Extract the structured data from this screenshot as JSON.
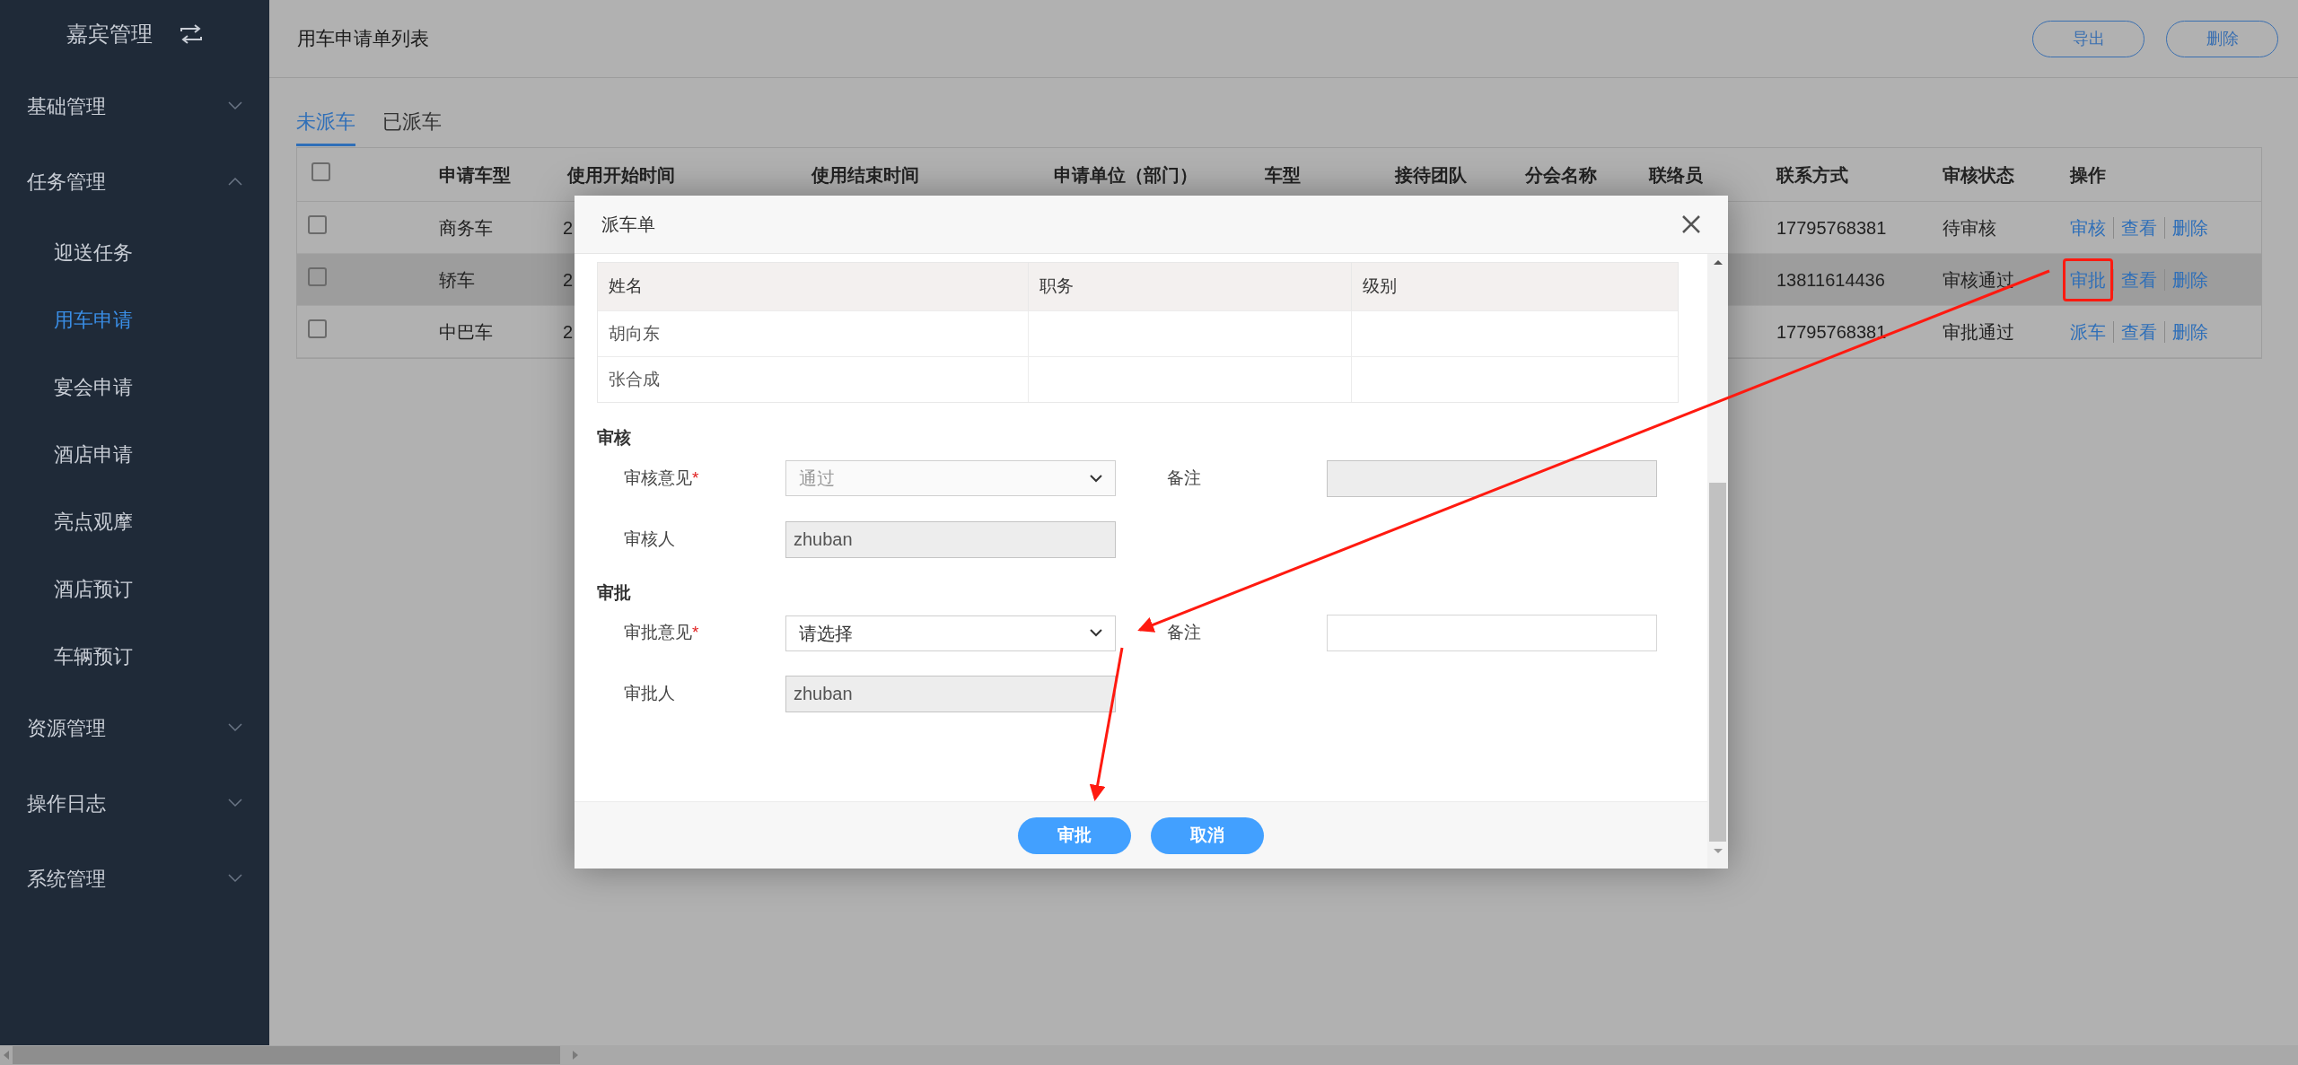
{
  "sidebar": {
    "title": "嘉宾管理",
    "groups": [
      {
        "label": "基础管理",
        "expanded": false
      },
      {
        "label": "任务管理",
        "expanded": true,
        "children": [
          {
            "label": "迎送任务",
            "selected": false
          },
          {
            "label": "用车申请",
            "selected": true
          },
          {
            "label": "宴会申请",
            "selected": false
          },
          {
            "label": "酒店申请",
            "selected": false
          },
          {
            "label": "亮点观摩",
            "selected": false
          },
          {
            "label": "酒店预订",
            "selected": false
          },
          {
            "label": "车辆预订",
            "selected": false
          }
        ]
      },
      {
        "label": "资源管理",
        "expanded": false
      },
      {
        "label": "操作日志",
        "expanded": false
      },
      {
        "label": "系统管理",
        "expanded": false
      }
    ]
  },
  "header": {
    "title": "用车申请单列表",
    "buttons": [
      "导出",
      "删除"
    ]
  },
  "tabs": [
    {
      "label": "未派车",
      "selected": true
    },
    {
      "label": "已派车",
      "selected": false
    }
  ],
  "table": {
    "select_all_checked": false,
    "columns": [
      "申请车型",
      "使用开始时间",
      "使用结束时间",
      "申请单位（部门）",
      "车型",
      "接待团队",
      "分会名称",
      "联络员",
      "联系方式",
      "审核状态",
      "操作"
    ],
    "rows": [
      {
        "checked": false,
        "hovered": false,
        "vehicle_type": "商务车",
        "start_time": "2",
        "phone": "17795768381",
        "status": "待审核",
        "actions": [
          {
            "label": "审核",
            "annotated": false
          },
          {
            "label": "查看",
            "annotated": false
          },
          {
            "label": "删除",
            "annotated": false
          }
        ]
      },
      {
        "checked": false,
        "hovered": true,
        "vehicle_type": "轿车",
        "start_time": "2",
        "phone": "13811614436",
        "status": "审核通过",
        "actions": [
          {
            "label": "审批",
            "annotated": true
          },
          {
            "label": "查看",
            "annotated": false
          },
          {
            "label": "删除",
            "annotated": false
          }
        ]
      },
      {
        "checked": false,
        "hovered": false,
        "vehicle_type": "中巴车",
        "start_time": "2",
        "phone": "17795768381",
        "status": "审批通过",
        "actions": [
          {
            "label": "派车",
            "annotated": false
          },
          {
            "label": "查看",
            "annotated": false
          },
          {
            "label": "删除",
            "annotated": false
          }
        ]
      }
    ]
  },
  "modal": {
    "title": "派车单",
    "members": {
      "columns": [
        "姓名",
        "职务",
        "级别"
      ],
      "rows": [
        {
          "name": "胡向东"
        },
        {
          "name": "张合成"
        }
      ]
    },
    "sections": [
      {
        "title": "审核",
        "fields": [
          {
            "label": "审核意见",
            "required_mark": "*",
            "kind": "select",
            "value": "通过",
            "disabled": true
          },
          {
            "label": "备注",
            "kind": "input",
            "disabled": true
          },
          {
            "label": "审核人",
            "kind": "input",
            "value": "zhuban",
            "disabled": true
          }
        ]
      },
      {
        "title": "审批",
        "fields": [
          {
            "label": "审批意见",
            "required_mark": "*",
            "kind": "select",
            "value": "请选择",
            "disabled": false
          },
          {
            "label": "备注",
            "kind": "input",
            "disabled": false
          },
          {
            "label": "审批人",
            "kind": "input",
            "value": "zhuban",
            "disabled": true
          }
        ]
      }
    ],
    "buttons": [
      "审批",
      "取消"
    ]
  }
}
